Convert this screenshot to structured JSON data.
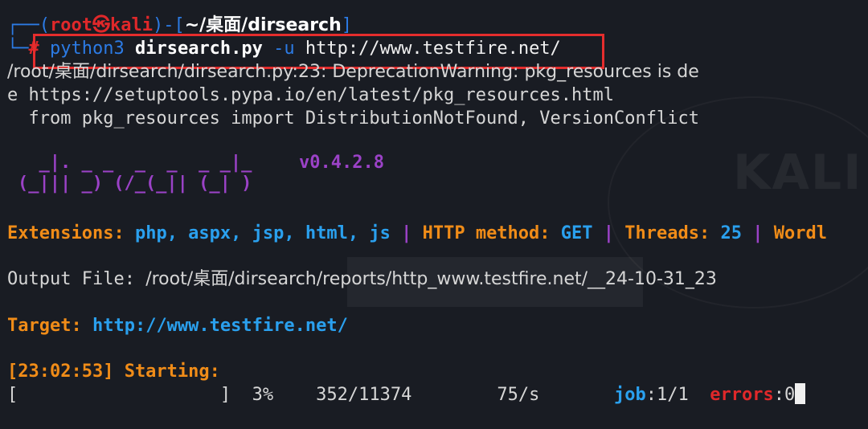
{
  "prompt": {
    "open": "┌──(",
    "user_host": "root㉿kali",
    "mid": ")-[",
    "cwd": "~/桌面/dirsearch",
    "close": "]",
    "corner": "└─",
    "hash": "#"
  },
  "command": {
    "python": "python3",
    "script": "dirsearch.py",
    "flag": "-u",
    "url": "http://www.testfire.net/"
  },
  "warning": {
    "line1": "/root/桌面/dirsearch/dirsearch.py:23: DeprecationWarning: pkg_resources is de",
    "line2": "e https://setuptools.pypa.io/en/latest/pkg_resources.html",
    "line3": "  from pkg_resources import DistributionNotFound, VersionConflict"
  },
  "banner": {
    "logo_line1": "  _|. _ _  _  _  _ _|_",
    "logo_line2": "(_||| _) (/_(_|| (_| )",
    "version": "v0.4.2.8"
  },
  "config": {
    "ext_label": "Extensions:",
    "ext_value": "php, aspx, jsp, html, js",
    "sep1": "|",
    "method_label": "HTTP method:",
    "method_value": "GET",
    "sep2": "|",
    "threads_label": "Threads:",
    "threads_value": "25",
    "sep3": "|",
    "wordlist_label": "Wordl"
  },
  "output": {
    "label": "Output File:",
    "path": "/root/桌面/dirsearch/reports/http_www.testfire.net/__24-10-31_23"
  },
  "target": {
    "label": "Target:",
    "url": "http://www.testfire.net/"
  },
  "start": {
    "text": "[23:02:53] Starting:"
  },
  "progress": {
    "bar": "[                   ]",
    "percent": "3%",
    "count": "352/11374",
    "rate": "75/s",
    "job_label": "job",
    "job_value": ":1/1",
    "errors_label": "errors",
    "errors_value": ":0"
  },
  "colors": {
    "background": "#191c23",
    "prompt_blue": "#2c7be5",
    "prompt_red": "#e0282a",
    "orange": "#f08c18",
    "light_blue": "#2aa0ee",
    "purple": "#9b42c7",
    "highlight_box": "#e52d2d"
  }
}
